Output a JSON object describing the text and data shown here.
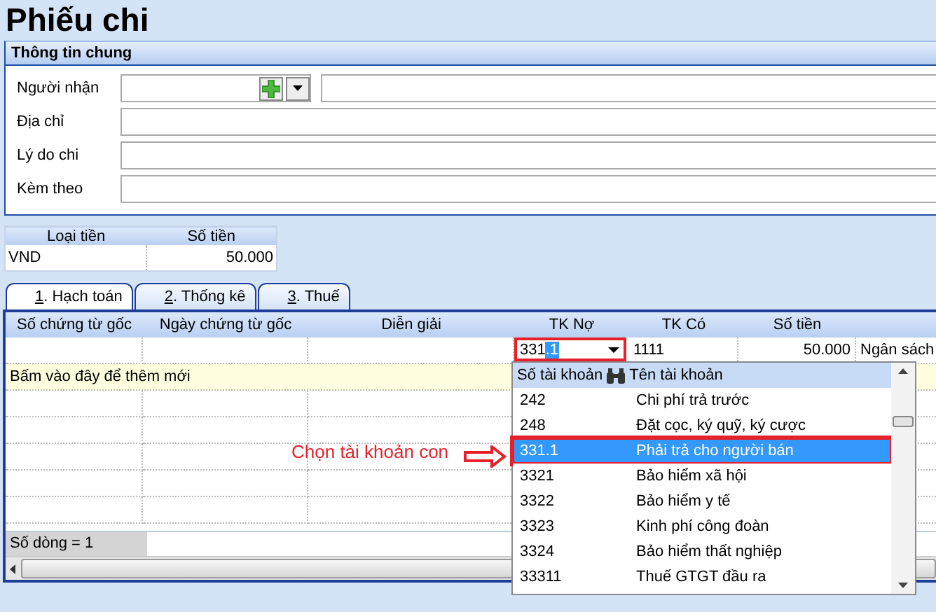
{
  "title": "Phiếu chi",
  "general_info": {
    "title": "Thông tin chung",
    "fields": [
      {
        "label": "Người nhận",
        "kind": "combo"
      },
      {
        "label": "Địa chỉ",
        "kind": "text"
      },
      {
        "label": "Lý do chi",
        "kind": "text"
      },
      {
        "label": "Kèm theo",
        "kind": "text"
      }
    ]
  },
  "currency_table": {
    "columns": [
      "Loại tiền",
      "Số tiền"
    ],
    "rows": [
      [
        "VND",
        "50.000"
      ]
    ]
  },
  "tabs": [
    {
      "key": "1",
      "label": ". Hạch toán",
      "selected": true
    },
    {
      "key": "2",
      "label": ". Thống kê",
      "selected": false
    },
    {
      "key": "3",
      "label": ". Thuế",
      "selected": false
    }
  ],
  "grid": {
    "columns": [
      "Số chứng từ gốc",
      "Ngày chứng từ gốc",
      "Diễn giải",
      "TK Nợ",
      "TK Có",
      "Số tiền"
    ],
    "row": {
      "debit_typed": "331",
      "debit_highlighted": ".1",
      "credit": "1111",
      "amount": "50.000",
      "budget": "Ngân sách"
    },
    "new_row_hint": "Bấm vào đây để thêm mới",
    "footer": "Số dòng = 1"
  },
  "account_dropdown": {
    "columns": [
      "Số tài khoản",
      "Tên tài khoản"
    ],
    "items": [
      {
        "code": "242",
        "name": "Chi phí trả trước",
        "selected": false
      },
      {
        "code": "248",
        "name": "Đặt cọc, ký quỹ, ký cược",
        "selected": false
      },
      {
        "code": "331.1",
        "name": "Phải trả cho người bán",
        "selected": true
      },
      {
        "code": "3321",
        "name": "Bảo hiểm xã hội",
        "selected": false
      },
      {
        "code": "3322",
        "name": "Bảo hiểm y tế",
        "selected": false
      },
      {
        "code": "3323",
        "name": "Kinh phí công đoàn",
        "selected": false
      },
      {
        "code": "3324",
        "name": "Bảo hiểm thất nghiệp",
        "selected": false
      },
      {
        "code": "33311",
        "name": "Thuế GTGT đầu ra",
        "selected": false
      }
    ]
  },
  "annotation": {
    "text": "Chọn tài khoản con"
  }
}
